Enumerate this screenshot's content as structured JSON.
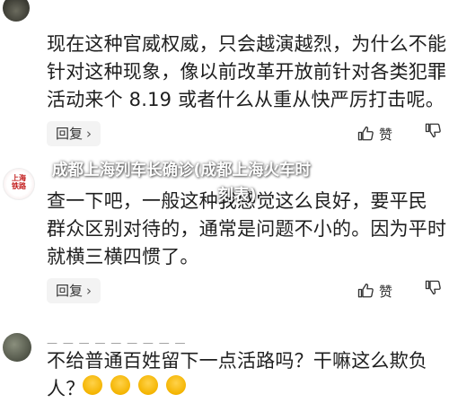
{
  "comments": [
    {
      "lines": [
        "现在这种官威权威，只会越演越烈，为什么不能",
        "针对这种现象，像以前改革开放前针对各类犯罪",
        "活动来个 8.19 或者什么从重从快严厉打击呢。"
      ],
      "reply_label": "回复",
      "like_label": "赞"
    },
    {
      "lines": [
        "查一下吧，一般这种我感觉这么良好，要平民",
        "群众区别对待的，通常是问题不小的。因为平时",
        "就横三横四惯了。"
      ],
      "reply_label": "回复",
      "like_label": "赞",
      "avatar_seal_text": "上海铁路"
    },
    {
      "meta_faded": "— — — — — — — — —",
      "lines": [
        "不给普通百姓留下一点活路吗？干嘛这么欺负",
        "人？"
      ]
    }
  ],
  "overlay": {
    "title_line1": "成都上海列车长确诊(成都上海火车时",
    "title_line2": "刻表)"
  },
  "icons": {
    "chevron": "chevron-right-icon",
    "like": "thumbs-up-icon",
    "dislike": "thumbs-down-icon"
  }
}
